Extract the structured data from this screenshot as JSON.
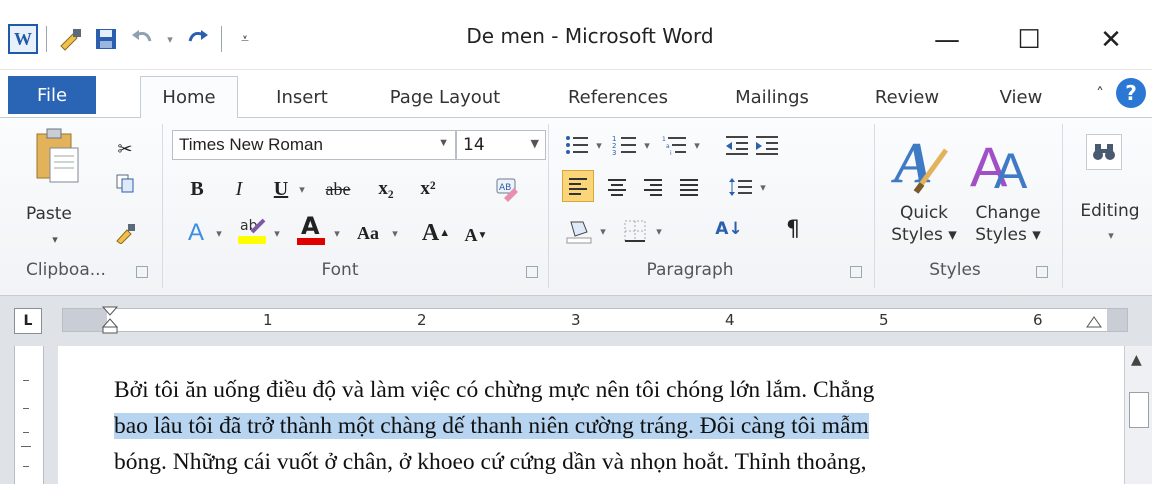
{
  "window": {
    "title": "De men - Microsoft Word",
    "minimize_glyph": "—",
    "maximize_glyph": "☐",
    "close_glyph": "✕"
  },
  "qat": {
    "app_icon": "W",
    "icons": [
      "word-app-icon",
      "format-painter-icon",
      "save-icon",
      "undo-icon",
      "redo-icon",
      "customize-qat-icon"
    ]
  },
  "tabs": [
    "File",
    "Home",
    "Insert",
    "Page Layout",
    "References",
    "Mailings",
    "Review",
    "View"
  ],
  "ribbon": {
    "clipboard": {
      "paste_label": "Paste",
      "group_label": "Clipboa..."
    },
    "font": {
      "name": "Times New Roman",
      "size": "14",
      "bold": "B",
      "italic": "I",
      "underline": "U",
      "strike": "abe",
      "subscript": "x₂",
      "superscript": "x²",
      "grow": "A",
      "shrink": "A",
      "case": "Aa",
      "group_label": "Font"
    },
    "paragraph": {
      "pilcrow": "¶",
      "sort": "A↓",
      "group_label": "Paragraph"
    },
    "styles": {
      "quick_line1": "Quick",
      "quick_line2": "Styles ▾",
      "change_line1": "Change",
      "change_line2": "Styles ▾",
      "group_label": "Styles"
    },
    "editing": {
      "label": "Editing"
    }
  },
  "ruler": {
    "tab_selector": "L",
    "numbers": [
      "1",
      "2",
      "3",
      "4",
      "5",
      "6"
    ]
  },
  "document": {
    "line1": "Bởi tôi ăn uống điều độ và làm việc có chừng mực nên tôi chóng lớn lắm. Chẳng",
    "line2": "bao lâu tôi đã trở thành một chàng dế thanh niên cường tráng. Đôi càng tôi mẫm",
    "line3": "bóng. Những cái vuốt ở chân, ở khoeo cứ cứng dần và nhọn hoắt. Thỉnh thoảng,"
  },
  "colors": {
    "file_tab": "#2a64b5",
    "selection": "#b7d4f0",
    "highlight_yellow": "#ffff00",
    "font_color_red": "#e00000"
  }
}
